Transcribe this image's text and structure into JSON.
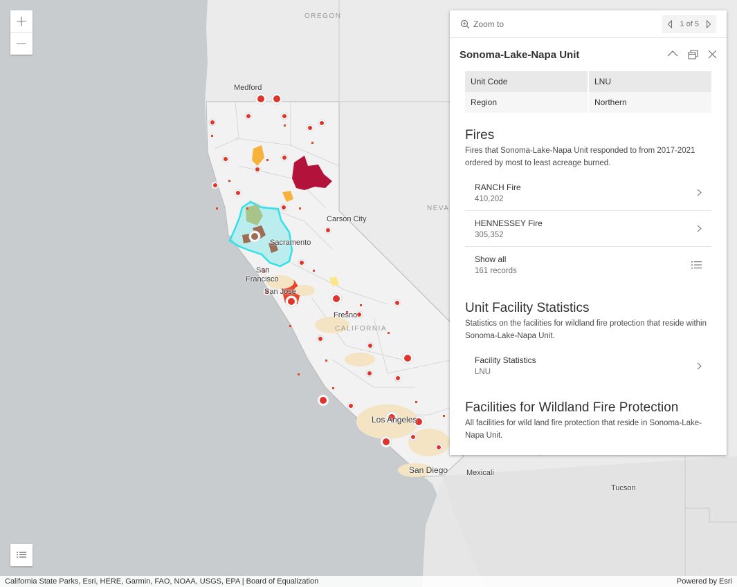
{
  "map": {
    "state_labels": {
      "oregon": "OREGON",
      "nevada": "NEVA",
      "california": "CALIFORNIA"
    },
    "cities": {
      "medford": "Medford",
      "carson_city": "Carson City",
      "sacramento": "Sacramento",
      "san_francisco_1": "San",
      "san_francisco_2": "Francisco",
      "san_jose": "San Jose",
      "fresno": "Fresno",
      "los_angeles": "Los Angeles",
      "san_diego": "San Diego",
      "mexicali": "Mexicali",
      "tucson": "Tucson"
    },
    "controls": {
      "zoom_in": "+",
      "zoom_out": "−"
    }
  },
  "attribution": {
    "sources": "California State Parks, Esri, HERE, Garmin, FAO, NOAA, USGS, EPA | Board of Equalization",
    "powered_by": "Powered by Esri"
  },
  "popup": {
    "zoom_to": "Zoom to",
    "pager": "1 of 5",
    "title": "Sonoma-Lake-Napa Unit",
    "attributes": [
      {
        "label": "Unit Code",
        "value": "LNU"
      },
      {
        "label": "Region",
        "value": "Northern"
      }
    ],
    "fires": {
      "title": "Fires",
      "description": "Fires that Sonoma-Lake-Napa Unit responded to from 2017-2021 ordered by most to least acreage burned.",
      "items": [
        {
          "name": "RANCH Fire",
          "value": "410,202"
        },
        {
          "name": "HENNESSEY Fire",
          "value": "305,352"
        }
      ],
      "show_all": {
        "label": "Show all",
        "records": "161 records"
      }
    },
    "stats": {
      "title": "Unit Facility Statistics",
      "description": "Statistics on the facilities for wildland fire protection that reside within Sonoma-Lake-Napa Unit.",
      "item": {
        "name": "Facility Statistics",
        "value": "LNU"
      }
    },
    "facilities": {
      "title": "Facilities for Wildland Fire Protection",
      "description": "All facilities for wild land fire protection that reside in Sonoma-Lake-Napa Unit."
    }
  }
}
